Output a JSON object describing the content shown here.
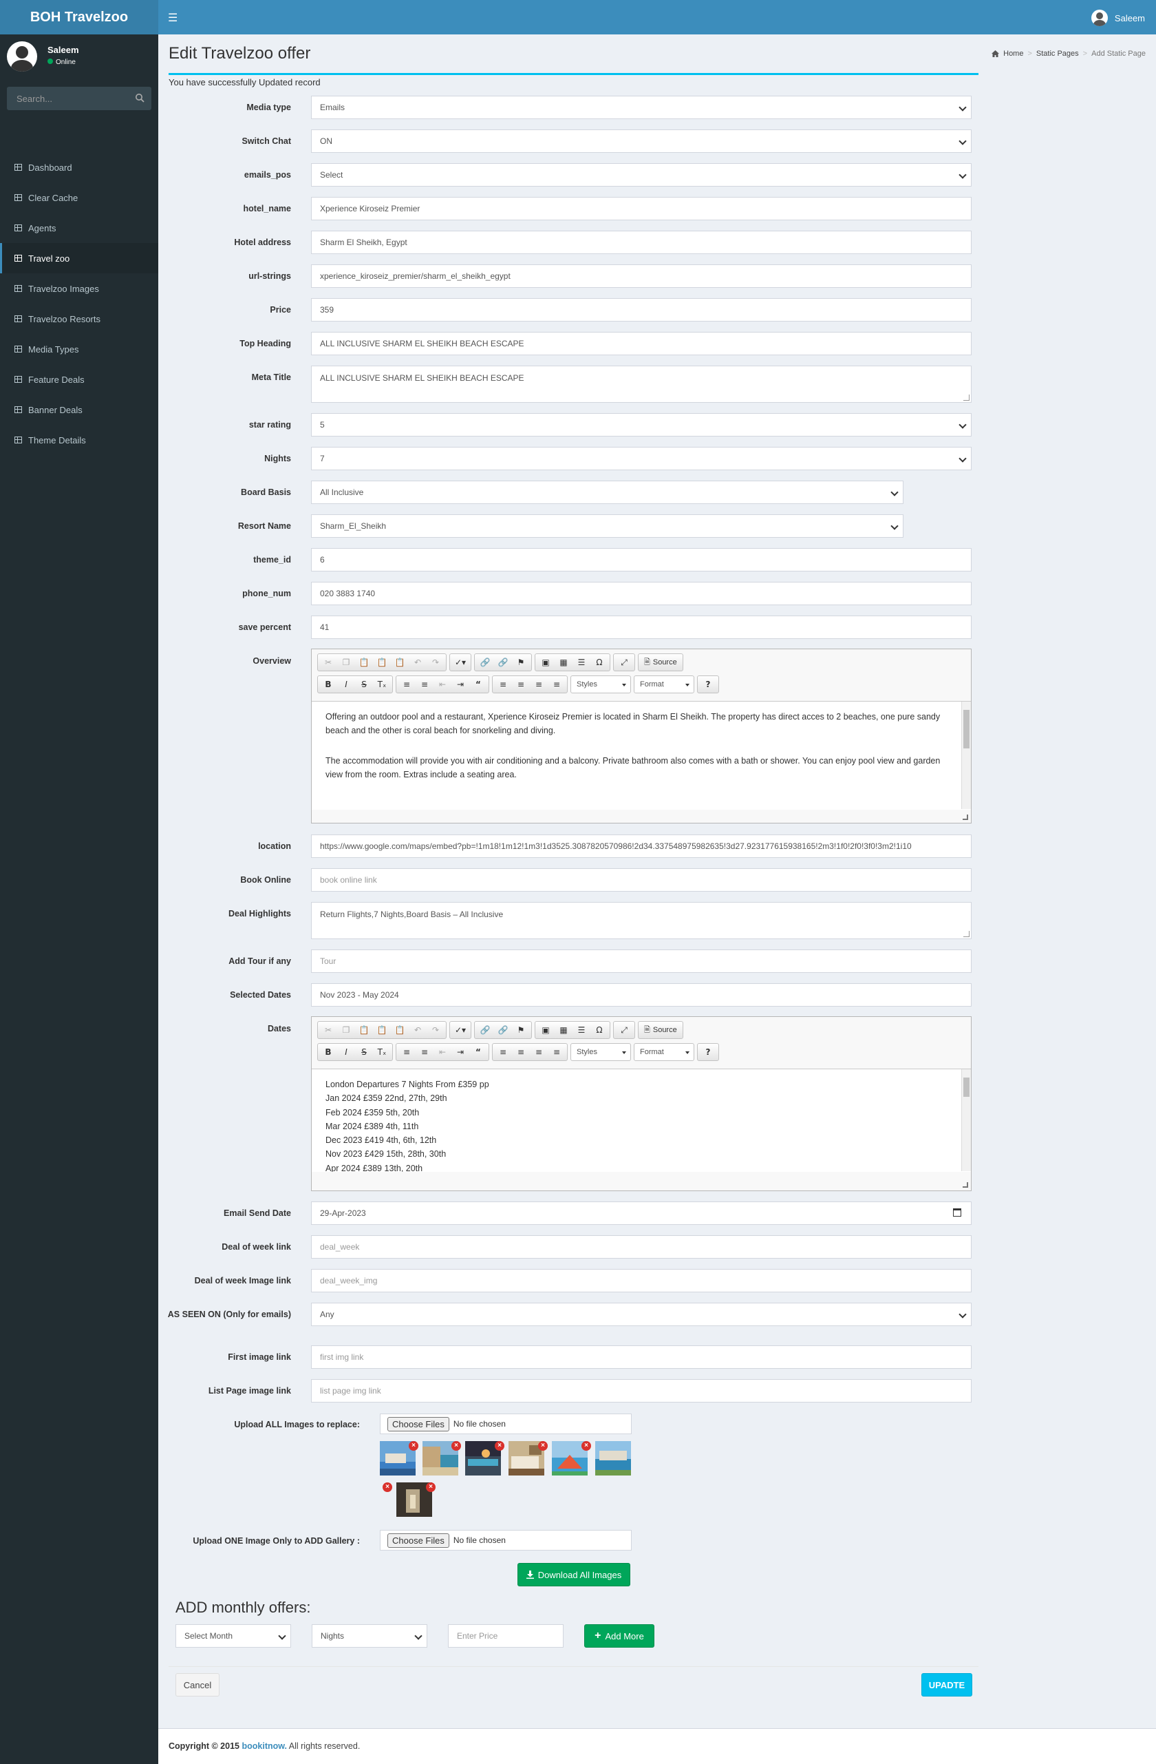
{
  "app": {
    "logo": "BOH Travelzoo",
    "user": "Saleem"
  },
  "sidebar": {
    "user": "Saleem",
    "status": "Online",
    "search_placeholder": "Search...",
    "items": [
      {
        "label": "Dashboard"
      },
      {
        "label": "Clear Cache"
      },
      {
        "label": "Agents"
      },
      {
        "label": "Travel zoo",
        "active": true
      },
      {
        "label": "Travelzoo Images"
      },
      {
        "label": "Travelzoo Resorts"
      },
      {
        "label": "Media Types"
      },
      {
        "label": "Feature Deals"
      },
      {
        "label": "Banner Deals"
      },
      {
        "label": "Theme Details"
      }
    ]
  },
  "page": {
    "title": "Edit Travelzoo offer",
    "success": "You have successfully Updated record"
  },
  "breadcrumb": {
    "home": "Home",
    "level1": "Static Pages",
    "current": "Add Static Page"
  },
  "form": {
    "media_type": {
      "label": "Media type",
      "value": "Emails"
    },
    "switch_chat": {
      "label": "Switch Chat",
      "value": "ON"
    },
    "emails_pos": {
      "label": "emails_pos",
      "value": "Select"
    },
    "hotel_name": {
      "label": "hotel_name",
      "value": "Xperience Kiroseiz Premier"
    },
    "hotel_address": {
      "label": "Hotel address",
      "value": "Sharm El Sheikh, Egypt"
    },
    "url_strings": {
      "label": "url-strings",
      "value": "xperience_kiroseiz_premier/sharm_el_sheikh_egypt"
    },
    "price": {
      "label": "Price",
      "value": "359"
    },
    "top_heading": {
      "label": "Top Heading",
      "value": "ALL INCLUSIVE SHARM EL SHEIKH BEACH ESCAPE"
    },
    "meta_title": {
      "label": "Meta Title",
      "value": "ALL INCLUSIVE SHARM EL SHEIKH BEACH ESCAPE"
    },
    "star_rating": {
      "label": "star rating",
      "value": "5"
    },
    "nights": {
      "label": "Nights",
      "value": "7"
    },
    "board_basis": {
      "label": "Board Basis",
      "value": "All Inclusive"
    },
    "resort_name": {
      "label": "Resort Name",
      "value": "Sharm_El_Sheikh"
    },
    "theme_id": {
      "label": "theme_id",
      "value": "6"
    },
    "phone_num": {
      "label": "phone_num",
      "value": "020 3883 1740"
    },
    "save_percent": {
      "label": "save percent",
      "value": "41"
    },
    "overview": {
      "label": "Overview",
      "p1": "Offering an outdoor pool and a restaurant, Xperience Kiroseiz Premier is located in Sharm El Sheikh. The property has direct acces to 2 beaches, one pure sandy beach and the other is coral beach for snorkeling and diving.",
      "p2": "The accommodation will provide you with air conditioning and a balcony. Private bathroom also comes with a bath or shower. You can enjoy pool view and garden view from the room. Extras include a seating area."
    },
    "location": {
      "label": "location",
      "value": "https://www.google.com/maps/embed?pb=!1m18!1m12!1m3!1d3525.3087820570986!2d34.337548975982635!3d27.923177615938165!2m3!1f0!2f0!3f0!3m2!1i10"
    },
    "book_online": {
      "label": "Book Online",
      "placeholder": "book online link"
    },
    "deal_highlights": {
      "label": "Deal Highlights",
      "value": "Return Flights,7 Nights,Board Basis – All Inclusive"
    },
    "add_tour": {
      "label": "Add Tour if any",
      "placeholder": "Tour"
    },
    "selected_dates": {
      "label": "Selected Dates",
      "value": "Nov 2023 - May 2024"
    },
    "dates": {
      "label": "Dates",
      "lines": [
        "London Departures 7 Nights From £359 pp",
        "Jan 2024 £359 22nd, 27th, 29th",
        "Feb 2024 £359 5th, 20th",
        "Mar 2024 £389 4th, 11th",
        "Dec 2023 £419 4th, 6th, 12th",
        "Nov 2023 £429 15th, 28th, 30th",
        "Apr 2024 £389 13th, 20th"
      ]
    },
    "email_send_date": {
      "label": "Email Send Date",
      "value": "29-Apr-2023"
    },
    "deal_of_week_link": {
      "label": "Deal of week link",
      "placeholder": "deal_week"
    },
    "deal_of_week_image": {
      "label": "Deal of week Image link",
      "placeholder": "deal_week_img"
    },
    "as_seen_on": {
      "label": "AS SEEN ON (Only for emails)",
      "value": "Any"
    },
    "first_image": {
      "label": "First image link",
      "placeholder": "first img link"
    },
    "list_page_image": {
      "label": "List Page image link",
      "placeholder": "list page img link"
    },
    "upload_all": {
      "label": "Upload ALL Images to replace:",
      "button": "Choose Files",
      "status": "No file chosen"
    },
    "upload_one": {
      "label": "Upload ONE Image Only to ADD Gallery :",
      "button": "Choose Files",
      "status": "No file chosen"
    },
    "download_all": "Download All Images"
  },
  "editor": {
    "source": "Source",
    "styles": "Styles",
    "format": "Format"
  },
  "monthly": {
    "title": "ADD monthly offers:",
    "month": "Select Month",
    "nights": "Nights",
    "price_placeholder": "Enter Price",
    "add_more": "Add More"
  },
  "actions": {
    "cancel": "Cancel",
    "update": "UPADTE"
  },
  "footer": {
    "copyright": "Copyright © 2015",
    "brand": "bookitnow.",
    "rights": "All rights reserved."
  },
  "colors": {
    "header": "#3c8dbc",
    "sidebar": "#222d32",
    "accent": "#00c0ef",
    "green": "#00a65a"
  }
}
